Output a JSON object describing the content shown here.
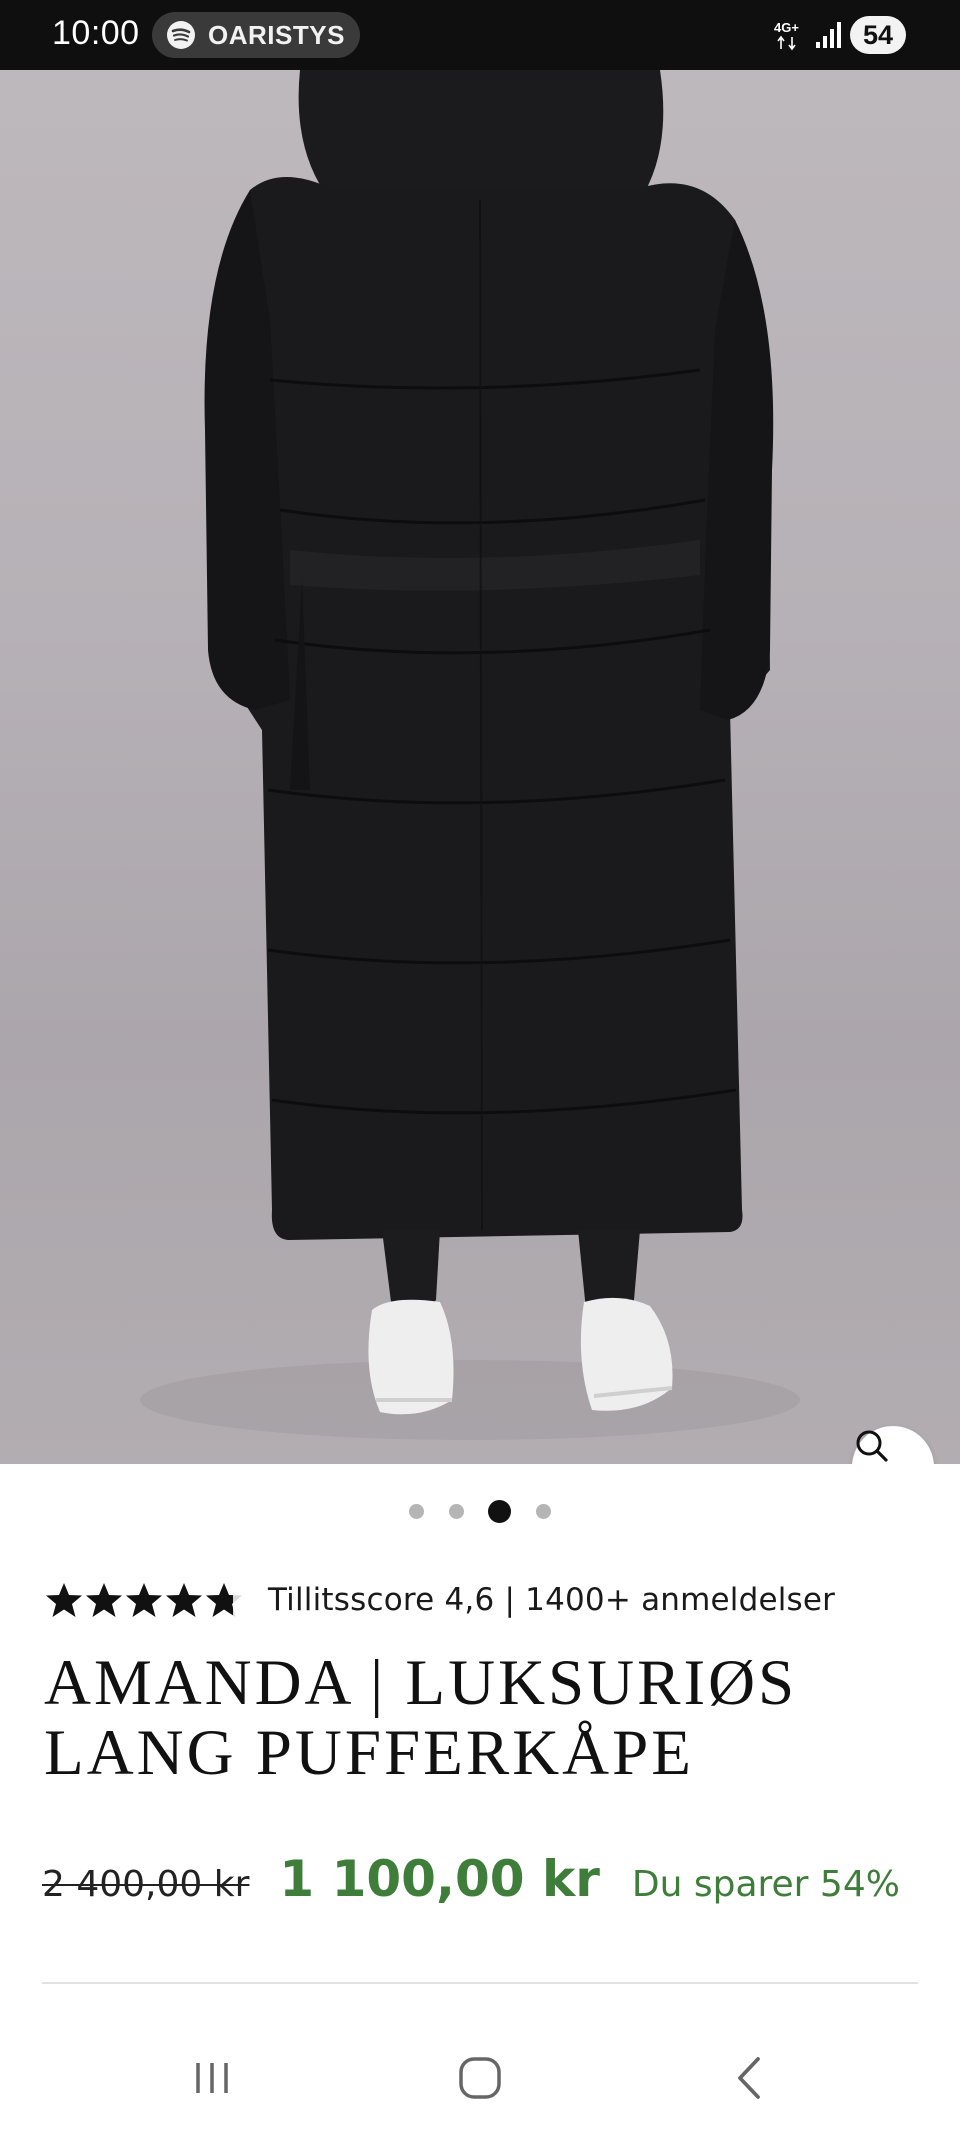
{
  "status_bar": {
    "time": "10:00",
    "media_app": "OARISTYS",
    "network": "4G+",
    "battery": "54"
  },
  "product": {
    "image_alt": "Long black puffer coat, back view",
    "carousel": {
      "count": 4,
      "active_index": 2
    },
    "rating": {
      "score": 4.6,
      "stars_max": 5,
      "text": "Tillitsscore 4,6 | 1400+ anmeldelser"
    },
    "title_line1": "AMANDA | LUKSURIØS",
    "title_line2": "LANG PUFFERKÅPE",
    "price_old": "2 400,00 kr",
    "price_new": "1 100,00 kr",
    "saving": "Du sparer 54%"
  },
  "colors": {
    "accent_green": "#3f7d3b",
    "status_bar_bg": "#0f0f0f"
  },
  "icons": {
    "zoom": "search-icon",
    "nav_recent": "recent-apps-icon",
    "nav_home": "home-icon",
    "nav_back": "back-icon"
  }
}
